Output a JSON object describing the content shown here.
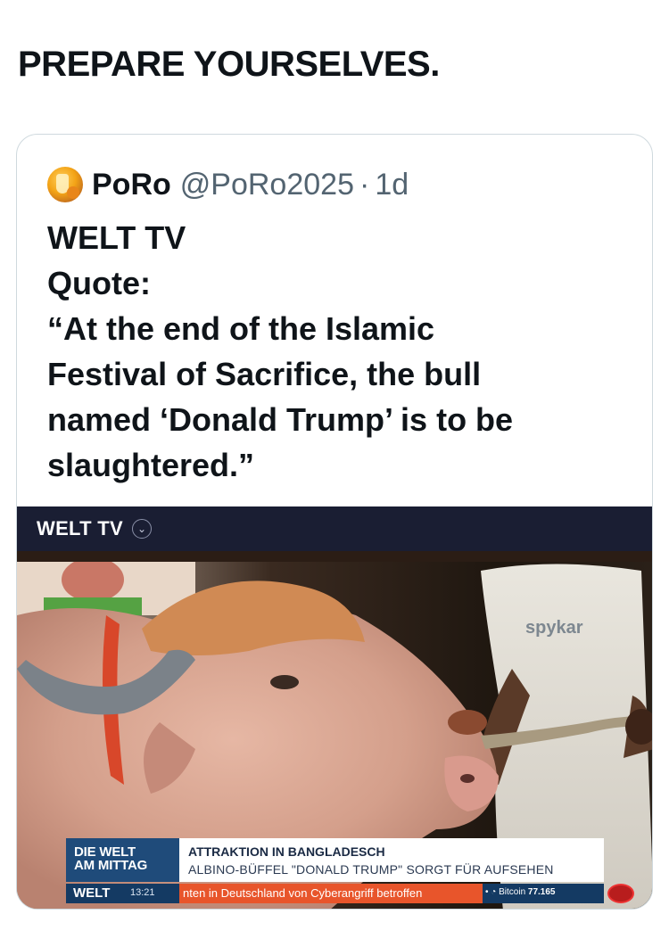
{
  "post": {
    "text": "PREPARE YOURSELVES."
  },
  "quoted": {
    "avatar_icon": "orange-drink-avatar",
    "display_name": "PoRo",
    "handle": "@PoRo2025",
    "separator": "·",
    "time": "1d",
    "lines": [
      "WELT TV",
      "Quote:",
      "“At the end of the Islamic",
      "Festival of Sacrifice, the bull",
      "named ‘Donald Trump’ is to be",
      "slaughtered.”"
    ]
  },
  "media": {
    "channel_label": "WELT TV",
    "channel_chevron_icon": "chevron-down-icon",
    "photo_logo_text": "spykar",
    "ticker": {
      "show_line1": "DIE WELT",
      "show_line2": "AM MITTAG",
      "headline": "ATTRAKTION IN BANGLADESCH",
      "subheadline": "ALBINO-BÜFFEL \"DONALD TRUMP\" SORGT FÜR AUFSEHEN",
      "brand": "WELT",
      "clock": "13:21",
      "news_crawl": "nten in Deutschland von Cyberangriff betroffen",
      "bitcoin_label": "Bitcoin",
      "bitcoin_value": "77.165"
    }
  },
  "colors": {
    "text_primary": "#0f1419",
    "text_secondary": "#536471",
    "card_border": "#cfd9de",
    "welt_bar": "#1a1e33"
  }
}
